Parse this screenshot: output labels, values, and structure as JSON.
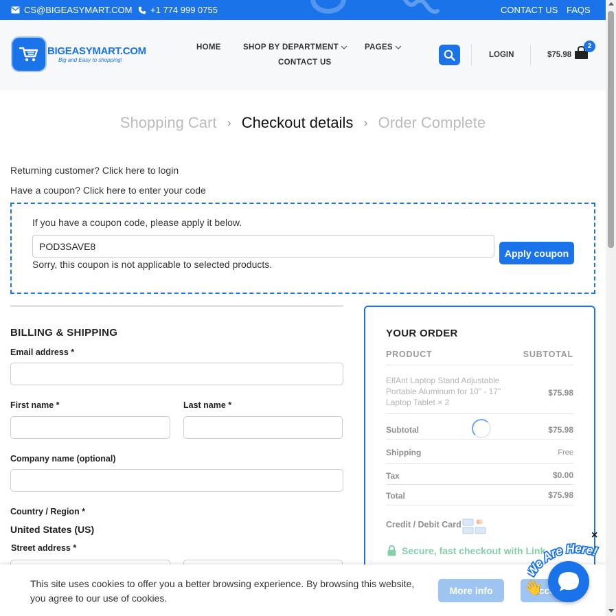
{
  "topbar": {
    "email": "CS@BIGEASYMART.COM",
    "phone": "+1 774 999 0755",
    "links": [
      "CONTACT US",
      "FAQS"
    ],
    "icons": [
      "envelope-icon",
      "phone-icon"
    ]
  },
  "header": {
    "logo_name": "BIGEASYMART.COM",
    "logo_tagline": "Big and Easy to shopping!",
    "nav": [
      "HOME",
      "SHOP BY DEPARTMENT",
      "PAGES",
      "CONTACT US"
    ],
    "login": "LOGIN",
    "cart_total": "$75.98",
    "cart_count": "2"
  },
  "breadcrumb": [
    "Shopping Cart",
    "Checkout details",
    "Order Complete"
  ],
  "notices": {
    "returning": "Returning customer? Click here to login",
    "coupon": "Have a coupon? Click here to enter your code"
  },
  "coupon": {
    "lead": "If you have a coupon code, please apply it below.",
    "value": "POD3SAVE8",
    "button": "Apply coupon",
    "error": "Sorry, this coupon is not applicable to selected products."
  },
  "billing": {
    "title": "BILLING & SHIPPING",
    "email_label": "Email address *",
    "first_name_label": "First name *",
    "last_name_label": "Last name *",
    "company_label": "Company name (optional)",
    "country_label": "Country / Region *",
    "country_value": "United States (US)",
    "street_label": "Street address *"
  },
  "order": {
    "title": "YOUR ORDER",
    "col_product": "PRODUCT",
    "col_subtotal": "SUBTOTAL",
    "product_name": "ElfAnt Laptop Stand Adjustable Portable Aluminum for 10\" - 17\" Laptop Tablet",
    "product_qty": "× 2",
    "product_price": "$75.98",
    "subtotal_label": "Subtotal",
    "subtotal_value": "$75.98",
    "shipping_label": "Shipping",
    "shipping_value": "Free",
    "tax_label": "Tax",
    "tax_value": "$0.00",
    "total_label": "Total",
    "total_value": "$75.98",
    "payment_label": "Credit / Debit Card",
    "secure_text": "Secure, fast checkout with Link"
  },
  "cookie": {
    "text": "This site uses cookies to offer you a better browsing experience. By browsing this website, you agree to our use of cookies.",
    "more_info": "More info",
    "accept": "Accept"
  },
  "chat": {
    "teaser": "We Are Here!",
    "close": "×"
  },
  "colors": {
    "brand": "#1a73e8",
    "success": "#84d0a9"
  }
}
